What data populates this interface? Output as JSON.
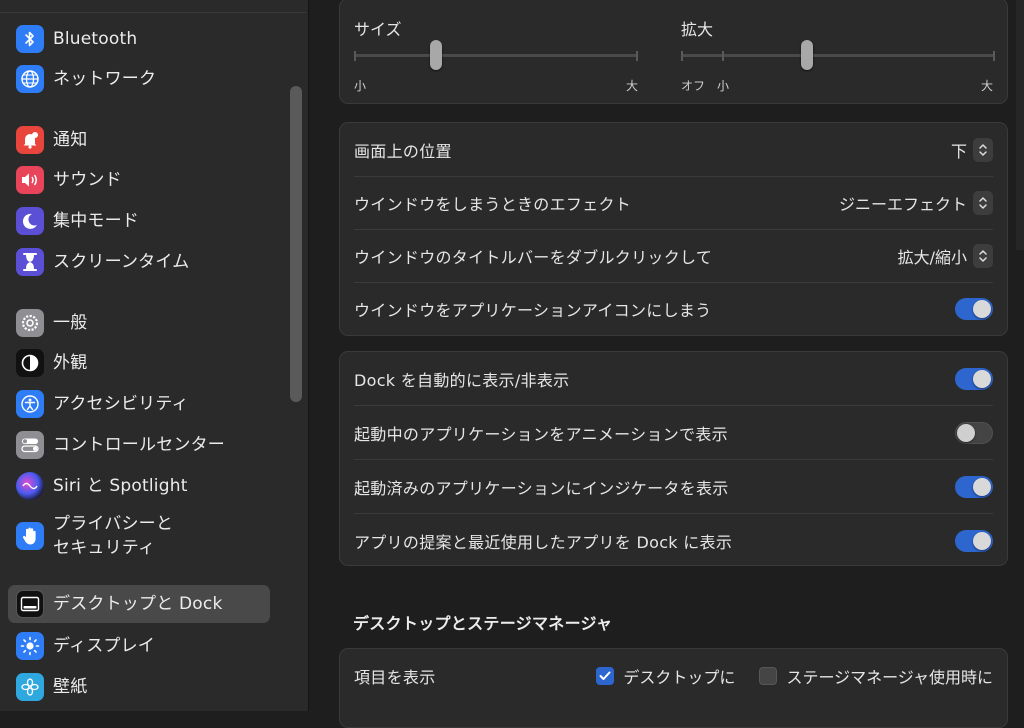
{
  "sidebar": {
    "items": [
      {
        "label": "Bluetooth",
        "icon": "bluetooth-icon",
        "color": "#2e7cf6"
      },
      {
        "label": "ネットワーク",
        "icon": "globe-icon",
        "color": "#2e7cf6"
      },
      {
        "label": "通知",
        "icon": "bell-icon",
        "color": "#e8453c"
      },
      {
        "label": "サウンド",
        "icon": "speaker-icon",
        "color": "#e8455a"
      },
      {
        "label": "集中モード",
        "icon": "moon-icon",
        "color": "#5b4fd6"
      },
      {
        "label": "スクリーンタイム",
        "icon": "hourglass-icon",
        "color": "#5b4fd6"
      },
      {
        "label": "一般",
        "icon": "gear-icon",
        "color": "#8e8e93"
      },
      {
        "label": "外観",
        "icon": "appearance-icon",
        "color": "#111111"
      },
      {
        "label": "アクセシビリティ",
        "icon": "accessibility-icon",
        "color": "#2e7cf6"
      },
      {
        "label": "コントロールセンター",
        "icon": "control-center-icon",
        "color": "#8e8e93"
      },
      {
        "label": "Siri と Spotlight",
        "icon": "siri-icon",
        "color": "#2a2a5a"
      },
      {
        "label": "プライバシーと",
        "label2": "セキュリティ",
        "icon": "hand-icon",
        "color": "#2e7cf6"
      },
      {
        "label": "デスクトップと Dock",
        "icon": "dock-icon",
        "color": "#111111",
        "selected": true
      },
      {
        "label": "ディスプレイ",
        "icon": "sun-icon",
        "color": "#2e7cf6"
      },
      {
        "label": "壁紙",
        "icon": "wallpaper-icon",
        "color": "#2fa8e0"
      }
    ]
  },
  "size_card": {
    "size_title": "サイズ",
    "size_min": "小",
    "size_max": "大",
    "size_value": 0.29,
    "mag_title": "拡大",
    "mag_off": "オフ",
    "mag_min": "小",
    "mag_max": "大",
    "mag_value": 0.4
  },
  "window_card": {
    "rows": [
      {
        "label": "画面上の位置",
        "value": "下"
      },
      {
        "label": "ウインドウをしまうときのエフェクト",
        "value": "ジニーエフェクト"
      },
      {
        "label": "ウインドウのタイトルバーをダブルクリックして",
        "value": "拡大/縮小"
      },
      {
        "label": "ウインドウをアプリケーションアイコンにしまう",
        "toggle": true
      }
    ]
  },
  "dock_card": {
    "rows": [
      {
        "label": "Dock を自動的に表示/非表示",
        "toggle": true
      },
      {
        "label": "起動中のアプリケーションをアニメーションで表示",
        "toggle": false
      },
      {
        "label": "起動済みのアプリケーションにインジケータを表示",
        "toggle": true
      },
      {
        "label": "アプリの提案と最近使用したアプリを Dock に表示",
        "toggle": true
      }
    ]
  },
  "stage_section": {
    "title": "デスクトップとステージマネージャ",
    "show_items_label": "項目を表示",
    "option_desktop": "デスクトップに",
    "option_desktop_checked": true,
    "option_stage": "ステージマネージャ使用時に",
    "option_stage_checked": false
  },
  "colors": {
    "accent": "#2e66cf",
    "selected_bg": "#4a494a"
  }
}
